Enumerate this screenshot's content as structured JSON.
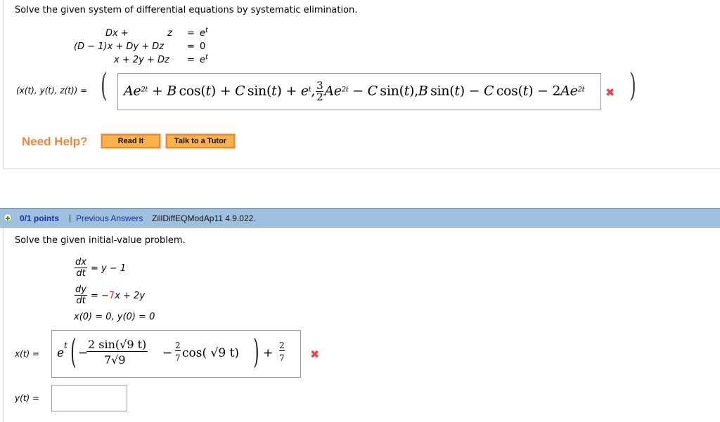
{
  "question1": {
    "prompt": "Solve the given system of differential equations by systematic elimination.",
    "system": {
      "row1": {
        "term1": "Dx +",
        "term2": "z",
        "eq": "=",
        "rhs_base": "e",
        "rhs_exp": "t"
      },
      "row2": {
        "lhs": "(D − 1)x + Dy + Dz",
        "eq": "=",
        "rhs": "0"
      },
      "row3": {
        "lhs": "x + 2y + Dz",
        "eq": "=",
        "rhs_base": "e",
        "rhs_exp": "t"
      }
    },
    "answer_label": "(x(t), y(t), z(t)) =",
    "answer": {
      "x_part": "Ae^{2t} + B cos(t) + C sin(t) + e^t",
      "y_part": "(3/2)Ae^{2t} − C sin(t)",
      "z_part": "B sin(t) − C cos(t) − 2Ae^{2t}",
      "pieces": {
        "a1": "A",
        "e": "e",
        "exp2t": "2t",
        "plusB": " + ",
        "B": "B",
        "cos": "cos",
        "lp": "(",
        "t": "t",
        "rp": ")",
        "C": "C",
        "sin": "sin",
        "expt": "t",
        "comma": ",",
        "frac_num": "3",
        "frac_den": "2",
        "minus": " − ",
        "two": "2"
      }
    },
    "status": "incorrect",
    "status_icon": "x-mark-icon",
    "help": {
      "label": "Need Help?",
      "read_it": "Read It",
      "talk_tutor": "Talk to a Tutor"
    }
  },
  "question2": {
    "header": {
      "points": "0/1 points",
      "separator": "|",
      "previous_answers": "Previous Answers",
      "question_id": "ZillDiffEQModAp11 4.9.022."
    },
    "prompt": "Solve the given initial-value problem.",
    "equations": {
      "eq1": {
        "num": "dx",
        "den": "dt",
        "rhs": "= y − 1"
      },
      "eq2": {
        "num": "dy",
        "den": "dt",
        "rhs_prefix": "= −",
        "coef": "7",
        "rhs_suffix": "x + 2y"
      },
      "initial": "x(0) = 0, y(0) = 0"
    },
    "x_label": "x(t) =",
    "x_answer": {
      "text": "e^t(−2 sin(√9 t)/(7√9) − (2/7)cos(√9 t)) + 2/7",
      "e": "e",
      "t": "t",
      "minus": "−",
      "num1": "2 sin(√9 t)",
      "den1": "7√9",
      "frac2_num": "2",
      "frac2_den": "7",
      "cos_part": "cos( √9 t)",
      "plus": "+",
      "frac3_num": "2",
      "frac3_den": "7"
    },
    "x_status": "incorrect",
    "y_label": "y(t) =",
    "y_answer": ""
  },
  "colors": {
    "help_orange": "#e8893a",
    "button_fill": "#fbb24a",
    "header_blue": "#9fc1de",
    "link_blue": "#1d2fa5",
    "error_red": "#e8424a",
    "highlight_red": "#e01b1b"
  }
}
